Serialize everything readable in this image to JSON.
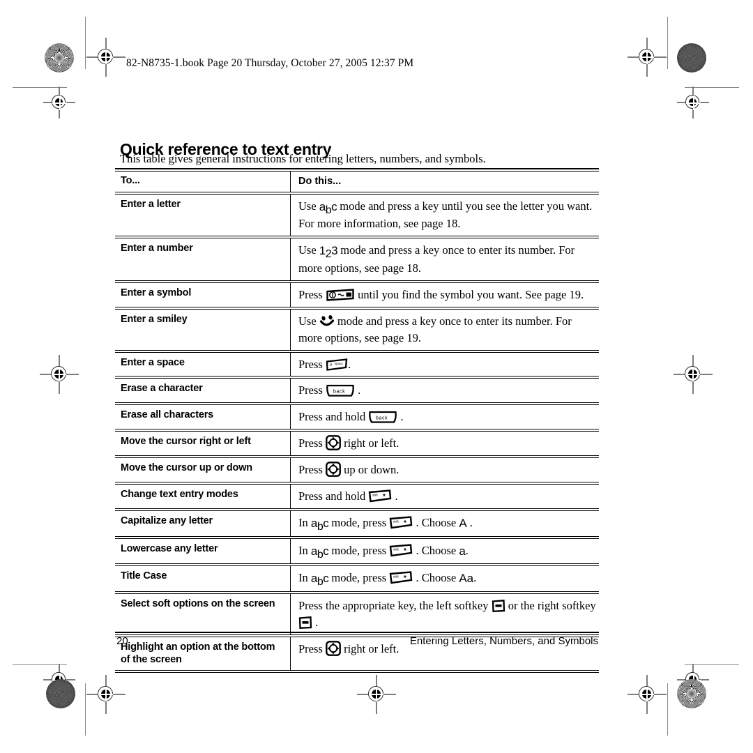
{
  "header": {
    "text": "82-N8735-1.book  Page 20  Thursday, October 27, 2005  12:37 PM"
  },
  "title": "Quick reference to text entry",
  "intro": "This table gives general instructions for entering letters, numbers, and symbols.",
  "table": {
    "columns": [
      "To...",
      "Do this..."
    ],
    "rows": [
      {
        "to": "Enter a letter",
        "parts": [
          {
            "t": "text",
            "v": "Use "
          },
          {
            "t": "mode",
            "v": "abc"
          },
          {
            "t": "text",
            "v": " mode and press a key until you see the letter you want. For more information, see page 18."
          }
        ]
      },
      {
        "to": "Enter a number",
        "parts": [
          {
            "t": "text",
            "v": "Use "
          },
          {
            "t": "mode",
            "v": "123"
          },
          {
            "t": "text",
            "v": " mode and press a key once to enter its number. For more options, see page 18."
          }
        ]
      },
      {
        "to": "Enter a symbol",
        "parts": [
          {
            "t": "text",
            "v": "Press "
          },
          {
            "t": "icon",
            "v": "symbol-key-icon"
          },
          {
            "t": "text",
            "v": " until you find the symbol you want. See page 19."
          }
        ]
      },
      {
        "to": "Enter a smiley",
        "parts": [
          {
            "t": "text",
            "v": "Use "
          },
          {
            "t": "icon",
            "v": "smiley-icon"
          },
          {
            "t": "text",
            "v": " mode and press a key once to enter its number. For more options, see page 19."
          }
        ]
      },
      {
        "to": "Enter a space",
        "parts": [
          {
            "t": "text",
            "v": "Press "
          },
          {
            "t": "icon",
            "v": "space-key-icon"
          },
          {
            "t": "text",
            "v": "."
          }
        ]
      },
      {
        "to": "Erase a character",
        "parts": [
          {
            "t": "text",
            "v": "Press "
          },
          {
            "t": "icon",
            "v": "back-key-icon"
          },
          {
            "t": "text",
            "v": " ."
          }
        ]
      },
      {
        "to": "Erase all characters",
        "parts": [
          {
            "t": "text",
            "v": "Press and hold "
          },
          {
            "t": "icon",
            "v": "back-key-icon"
          },
          {
            "t": "text",
            "v": " ."
          }
        ]
      },
      {
        "to": "Move the cursor right or left",
        "parts": [
          {
            "t": "text",
            "v": "Press "
          },
          {
            "t": "icon",
            "v": "navigation-key-icon"
          },
          {
            "t": "text",
            "v": " right or left."
          }
        ]
      },
      {
        "to": "Move the cursor up or down",
        "parts": [
          {
            "t": "text",
            "v": "Press "
          },
          {
            "t": "icon",
            "v": "navigation-key-icon"
          },
          {
            "t": "text",
            "v": " up or down."
          }
        ]
      },
      {
        "to": "Change text entry modes",
        "parts": [
          {
            "t": "text",
            "v": "Press and hold "
          },
          {
            "t": "icon",
            "v": "shift-key-icon"
          },
          {
            "t": "text",
            "v": " ."
          }
        ]
      },
      {
        "to": "Capitalize any letter",
        "parts": [
          {
            "t": "text",
            "v": "In "
          },
          {
            "t": "mode",
            "v": "abc"
          },
          {
            "t": "text",
            "v": " mode, press "
          },
          {
            "t": "icon",
            "v": "shift-key-icon"
          },
          {
            "t": "text",
            "v": " . Choose "
          },
          {
            "t": "choose",
            "v": "A"
          },
          {
            "t": "text",
            "v": " ."
          }
        ]
      },
      {
        "to": "Lowercase any letter",
        "parts": [
          {
            "t": "text",
            "v": "In "
          },
          {
            "t": "mode",
            "v": "abc"
          },
          {
            "t": "text",
            "v": " mode, press "
          },
          {
            "t": "icon",
            "v": "shift-key-icon"
          },
          {
            "t": "text",
            "v": " . Choose "
          },
          {
            "t": "choose",
            "v": "a"
          },
          {
            "t": "text",
            "v": "."
          }
        ]
      },
      {
        "to": "Title Case",
        "parts": [
          {
            "t": "text",
            "v": "In "
          },
          {
            "t": "mode",
            "v": "abc"
          },
          {
            "t": "text",
            "v": " mode, press "
          },
          {
            "t": "icon",
            "v": "shift-key-icon"
          },
          {
            "t": "text",
            "v": " . Choose "
          },
          {
            "t": "choose",
            "v": "Aa"
          },
          {
            "t": "text",
            "v": "."
          }
        ]
      },
      {
        "to": "Select soft options on the screen",
        "parts": [
          {
            "t": "text",
            "v": "Press the appropriate key, the left softkey "
          },
          {
            "t": "icon",
            "v": "left-softkey-icon"
          },
          {
            "t": "text",
            "v": " or the right softkey "
          },
          {
            "t": "icon",
            "v": "right-softkey-icon"
          },
          {
            "t": "text",
            "v": " ."
          }
        ]
      },
      {
        "to": "Highlight an option at the bottom of the screen",
        "parts": [
          {
            "t": "text",
            "v": "Press "
          },
          {
            "t": "icon",
            "v": "navigation-key-icon"
          },
          {
            "t": "text",
            "v": " right or left."
          }
        ]
      }
    ]
  },
  "footer": {
    "page_number": "20",
    "section": "Entering Letters, Numbers, and Symbols"
  },
  "key_icon_labels": {
    "space_key": "space",
    "back_key": "back",
    "shift_key": "shift"
  },
  "colors": {
    "ink": "#000000",
    "registration_gray": "#7d7d7d",
    "paper": "#ffffff"
  }
}
